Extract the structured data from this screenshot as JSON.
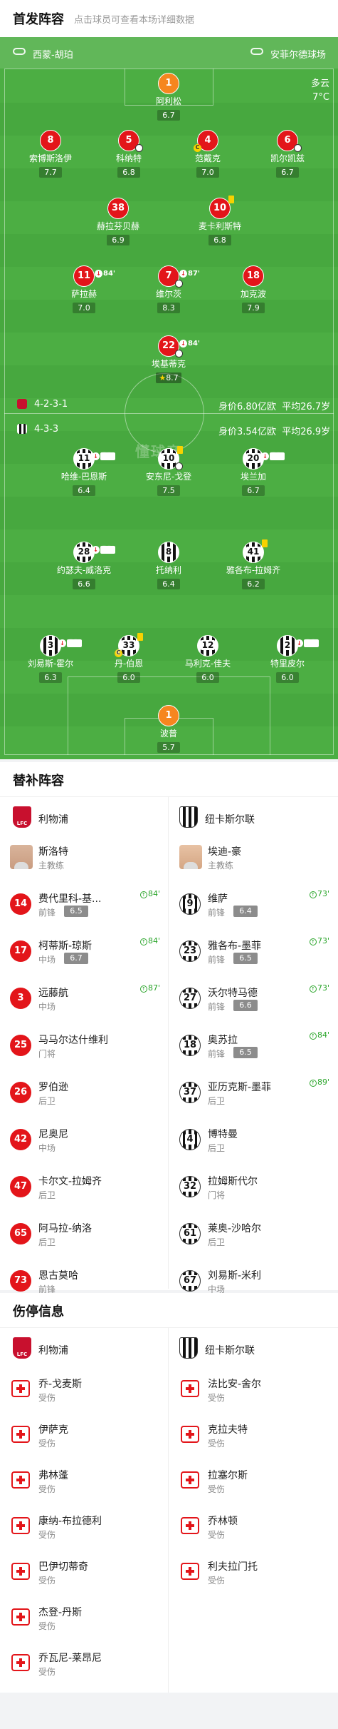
{
  "header": {
    "title": "首发阵容",
    "subtitle": "点击球员可查看本场详细数据"
  },
  "match": {
    "home_stadium": "西蒙-胡珀",
    "away_stadium": "安菲尔德球场",
    "weather": "多云",
    "temperature": "7°C",
    "watermark": "懂球帝"
  },
  "home_team": {
    "formation": "4-2-3-1",
    "value_text": "身价6.80亿欧",
    "avg_age_text": "平均26.7岁",
    "colors": {
      "primary": "#e3151a",
      "gk": "#f6861f"
    },
    "players": [
      {
        "num": "1",
        "name": "阿利松",
        "rating": "6.7",
        "role": "gk"
      },
      {
        "num": "8",
        "name": "索博斯洛伊",
        "rating": "7.7"
      },
      {
        "num": "5",
        "name": "科纳特",
        "rating": "6.8",
        "goal": true
      },
      {
        "num": "4",
        "name": "范戴克",
        "rating": "7.0",
        "captain": true
      },
      {
        "num": "6",
        "name": "凯尔凯兹",
        "rating": "6.7",
        "assist": true
      },
      {
        "num": "38",
        "name": "赫拉芬贝赫",
        "rating": "6.9"
      },
      {
        "num": "10",
        "name": "麦卡利斯特",
        "rating": "6.8",
        "yellow": true
      },
      {
        "num": "11",
        "name": "萨拉赫",
        "rating": "7.0",
        "sub_out": "84'"
      },
      {
        "num": "7",
        "name": "维尔茨",
        "rating": "8.3",
        "sub_out": "87'",
        "goal": true,
        "assist": true
      },
      {
        "num": "18",
        "name": "加克波",
        "rating": "7.9"
      },
      {
        "num": "22",
        "name": "埃基蒂克",
        "rating": "8.7",
        "sub_out": "84'",
        "goals": 2,
        "best": true
      }
    ]
  },
  "away_team": {
    "formation": "4-3-3",
    "value_text": "身价3.54亿欧",
    "avg_age_text": "平均26.9岁",
    "colors": {
      "primary": "#111111"
    },
    "players": [
      {
        "num": "11",
        "name": "哈维-巴恩斯",
        "rating": "6.4",
        "sub_out": "73'"
      },
      {
        "num": "10",
        "name": "安东尼-戈登",
        "rating": "7.5",
        "yellow": true,
        "goal": true
      },
      {
        "num": "20",
        "name": "埃兰加",
        "rating": "6.7",
        "sub_out": "73'"
      },
      {
        "num": "28",
        "name": "约瑟夫-威洛克",
        "rating": "6.6",
        "sub_out": "73'"
      },
      {
        "num": "8",
        "name": "托纳利",
        "rating": "6.4"
      },
      {
        "num": "41",
        "name": "雅各布-拉姆齐",
        "rating": "6.2",
        "yellow": true
      },
      {
        "num": "3",
        "name": "刘易斯-霍尔",
        "rating": "6.3",
        "sub_out": "89'"
      },
      {
        "num": "33",
        "name": "丹-伯恩",
        "rating": "6.0",
        "captain": true,
        "yellow": true
      },
      {
        "num": "12",
        "name": "马利克-佳夫",
        "rating": "6.0"
      },
      {
        "num": "2",
        "name": "特里皮尔",
        "rating": "6.0",
        "sub_out": "84'"
      },
      {
        "num": "1",
        "name": "波普",
        "rating": "5.7",
        "role": "gk"
      }
    ]
  },
  "subs": {
    "title": "替补阵容",
    "home": {
      "club": "利物浦",
      "coach": {
        "name": "斯洛特",
        "role": "主教练"
      },
      "players": [
        {
          "num": "14",
          "name": "费代里科-基...",
          "pos": "前锋",
          "rating": "6.5",
          "sub_in": "84'"
        },
        {
          "num": "17",
          "name": "柯蒂斯-琼斯",
          "pos": "中场",
          "rating": "6.7",
          "sub_in": "84'"
        },
        {
          "num": "3",
          "name": "远藤航",
          "pos": "中场",
          "rating": "",
          "sub_in": "87'"
        },
        {
          "num": "25",
          "name": "马马尔达什维利",
          "pos": "门将"
        },
        {
          "num": "26",
          "name": "罗伯逊",
          "pos": "后卫"
        },
        {
          "num": "42",
          "name": "尼奥尼",
          "pos": "中场"
        },
        {
          "num": "47",
          "name": "卡尔文-拉姆齐",
          "pos": "后卫"
        },
        {
          "num": "65",
          "name": "阿马拉-纳洛",
          "pos": "后卫"
        },
        {
          "num": "73",
          "name": "恩古莫哈",
          "pos": "前锋"
        }
      ]
    },
    "away": {
      "club": "纽卡斯尔联",
      "coach": {
        "name": "埃迪-豪",
        "role": "主教练"
      },
      "players": [
        {
          "num": "9",
          "name": "维萨",
          "pos": "前锋",
          "rating": "6.4",
          "sub_in": "73'"
        },
        {
          "num": "23",
          "name": "雅各布-墨菲",
          "pos": "前锋",
          "rating": "6.5",
          "sub_in": "73'"
        },
        {
          "num": "27",
          "name": "沃尔特马德",
          "pos": "前锋",
          "rating": "6.6",
          "sub_in": "73'"
        },
        {
          "num": "18",
          "name": "奥苏拉",
          "pos": "前锋",
          "rating": "6.5",
          "sub_in": "84'"
        },
        {
          "num": "37",
          "name": "亚历克斯-墨菲",
          "pos": "后卫",
          "rating": "",
          "sub_in": "89'"
        },
        {
          "num": "4",
          "name": "博特曼",
          "pos": "后卫"
        },
        {
          "num": "32",
          "name": "拉姆斯代尔",
          "pos": "门将"
        },
        {
          "num": "61",
          "name": "莱奥-沙哈尔",
          "pos": "后卫"
        },
        {
          "num": "67",
          "name": "刘易斯-米利",
          "pos": "中场"
        }
      ]
    }
  },
  "injuries": {
    "title": "伤停信息",
    "home": {
      "club": "利物浦",
      "players": [
        {
          "name": "乔-戈麦斯",
          "status": "受伤"
        },
        {
          "name": "伊萨克",
          "status": "受伤"
        },
        {
          "name": "弗林蓬",
          "status": "受伤"
        },
        {
          "name": "康纳-布拉德利",
          "status": "受伤"
        },
        {
          "name": "巴伊切蒂奇",
          "status": "受伤"
        },
        {
          "name": "杰登-丹斯",
          "status": "受伤"
        },
        {
          "name": "乔瓦尼-莱昂尼",
          "status": "受伤"
        }
      ]
    },
    "away": {
      "club": "纽卡斯尔联",
      "players": [
        {
          "name": "法比安-舍尔",
          "status": "受伤"
        },
        {
          "name": "克拉夫特",
          "status": "受伤"
        },
        {
          "name": "拉塞尔斯",
          "status": "受伤"
        },
        {
          "name": "乔林顿",
          "status": "受伤"
        },
        {
          "name": "利夫拉门托",
          "status": "受伤"
        }
      ]
    }
  }
}
